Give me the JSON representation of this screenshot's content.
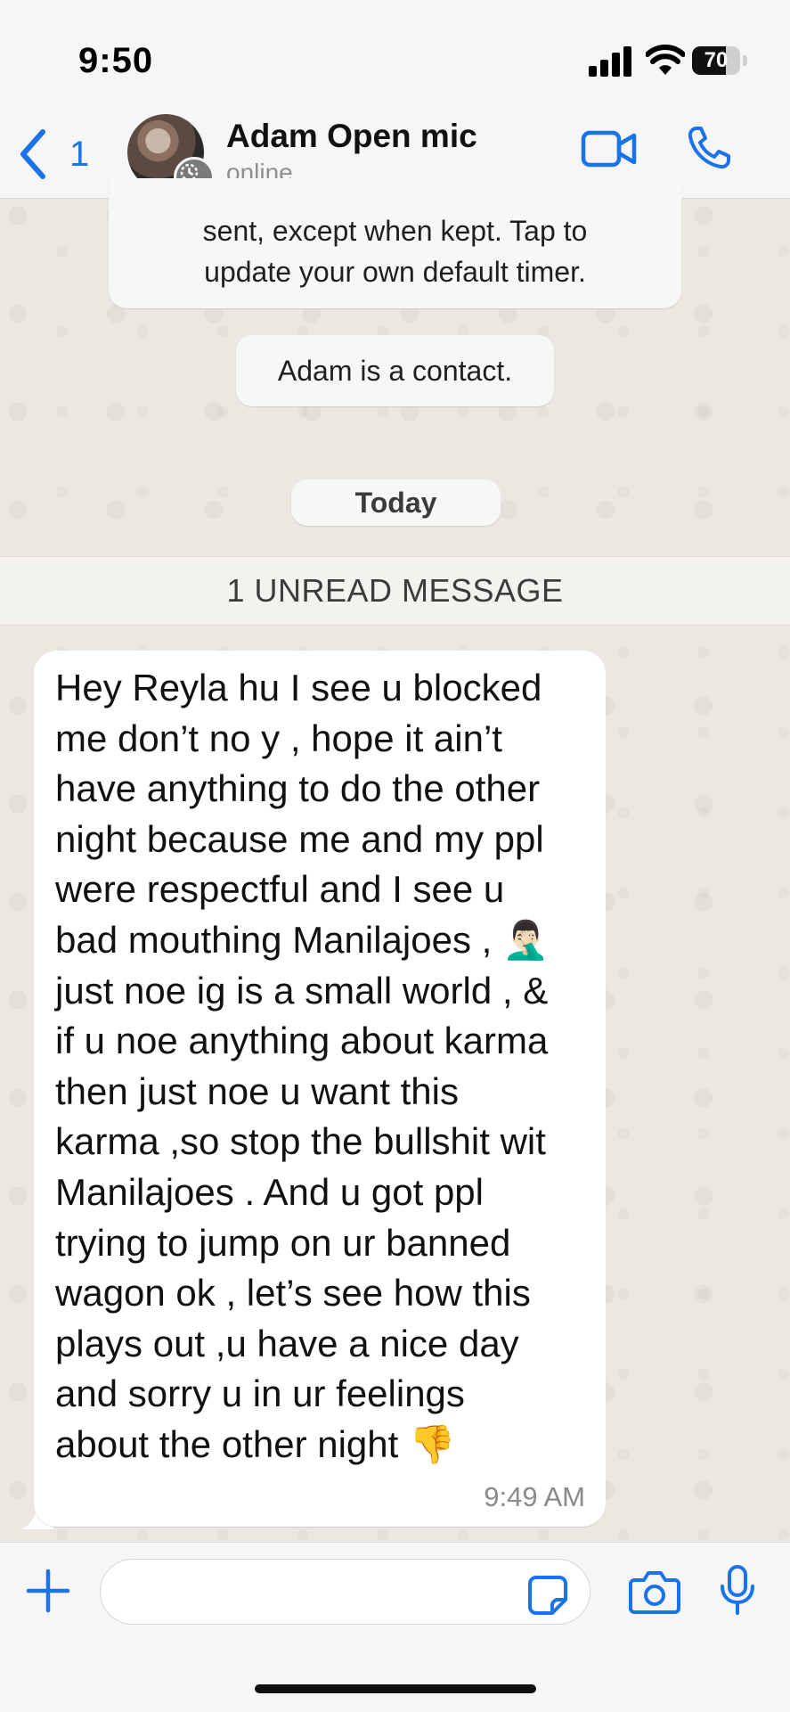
{
  "status_bar": {
    "time": "9:50",
    "battery_level": "70",
    "battery_fraction": 0.7
  },
  "header": {
    "back_count": "1",
    "contact_name": "Adam Open mic",
    "contact_status": "online",
    "accent_color": "#1a73e8"
  },
  "system_messages": {
    "disappearing_line1": "sent, except when kept. Tap to",
    "disappearing_line2": "update your own default timer.",
    "contact_note": "Adam is a contact.",
    "date_divider": "Today",
    "unread_banner": "1 UNREAD MESSAGE"
  },
  "message": {
    "lines": [
      "Hey Reyla hu I see u blocked",
      "me don’t no y , hope it ain’t",
      "have anything to do the other",
      "night because me and my ppl",
      "were respectful and I see u",
      "bad mouthing Manilajoes , 🤦🏻‍♂️",
      "just noe ig is a small world , &",
      "if u noe anything about karma",
      "then just noe u want this",
      "karma ,so stop the bullshit wit",
      "Manilajoes . And u got ppl",
      "trying to jump on ur banned",
      "wagon ok , let’s see how this",
      "plays out ,u have a nice day",
      "and sorry u in ur feelings",
      "about the other night 👎"
    ],
    "time": "9:49 AM"
  },
  "composer": {
    "placeholder": ""
  },
  "icons": {
    "back": "chevron-left-icon",
    "video": "video-camera-icon",
    "phone": "phone-icon",
    "plus": "plus-icon",
    "sticker": "sticker-icon",
    "camera": "camera-icon",
    "mic": "microphone-icon"
  }
}
